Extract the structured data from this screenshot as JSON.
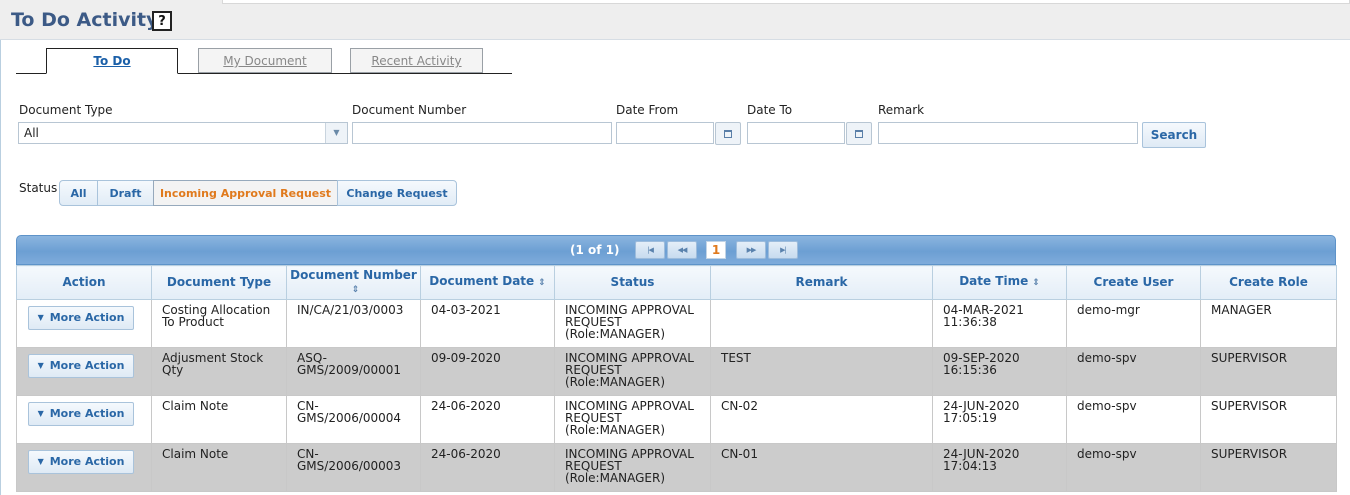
{
  "page": {
    "title": "To Do Activity",
    "help": "?"
  },
  "tabs": [
    {
      "label": "To Do",
      "active": true
    },
    {
      "label": "My Document",
      "active": false
    },
    {
      "label": "Recent Activity",
      "active": false
    }
  ],
  "filters": {
    "document_type": {
      "label": "Document Type",
      "value": "All"
    },
    "document_number": {
      "label": "Document Number",
      "value": ""
    },
    "date_from": {
      "label": "Date From",
      "value": ""
    },
    "date_to": {
      "label": "Date To",
      "value": ""
    },
    "remark": {
      "label": "Remark",
      "value": ""
    },
    "search_label": "Search"
  },
  "status": {
    "label": "Status",
    "options": [
      "All",
      "Draft",
      "Incoming Approval Request",
      "Change Request"
    ],
    "selected": "Incoming Approval Request"
  },
  "pager": {
    "text": "(1 of 1)",
    "current": "1"
  },
  "table": {
    "columns": [
      "Action",
      "Document Type",
      "Document Number",
      "Document Date",
      "Status",
      "Remark",
      "Date Time",
      "Create User",
      "Create Role"
    ],
    "action_label": "More Action",
    "rows": [
      {
        "document_type": [
          "Costing Allocation",
          "To Product"
        ],
        "document_number": [
          "IN/CA/21/03/0003"
        ],
        "document_date": "04-03-2021",
        "status": [
          "INCOMING APPROVAL",
          "REQUEST",
          "(Role:MANAGER)"
        ],
        "remark": "",
        "date_time": [
          "04-MAR-2021",
          "11:36:38"
        ],
        "create_user": "demo-mgr",
        "create_role": "MANAGER"
      },
      {
        "document_type": [
          "Adjusment Stock",
          "Qty"
        ],
        "document_number": [
          "ASQ-",
          "GMS/2009/00001"
        ],
        "document_date": "09-09-2020",
        "status": [
          "INCOMING APPROVAL",
          "REQUEST",
          "(Role:MANAGER)"
        ],
        "remark": "TEST",
        "date_time": [
          "09-SEP-2020",
          "16:15:36"
        ],
        "create_user": "demo-spv",
        "create_role": "SUPERVISOR"
      },
      {
        "document_type": [
          "Claim Note"
        ],
        "document_number": [
          "CN-",
          "GMS/2006/00004"
        ],
        "document_date": "24-06-2020",
        "status": [
          "INCOMING APPROVAL",
          "REQUEST",
          "(Role:MANAGER)"
        ],
        "remark": "CN-02",
        "date_time": [
          "24-JUN-2020",
          "17:05:19"
        ],
        "create_user": "demo-spv",
        "create_role": "SUPERVISOR"
      },
      {
        "document_type": [
          "Claim Note"
        ],
        "document_number": [
          "CN-",
          "GMS/2006/00003"
        ],
        "document_date": "24-06-2020",
        "status": [
          "INCOMING APPROVAL",
          "REQUEST",
          "(Role:MANAGER)"
        ],
        "remark": "CN-01",
        "date_time": [
          "24-JUN-2020",
          "17:04:13"
        ],
        "create_user": "demo-spv",
        "create_role": "SUPERVISOR"
      }
    ]
  },
  "colors": {
    "title": "#3c5a86",
    "link": "#2a67a6",
    "accent": "#e07a1d",
    "row_alt": "#cccccc"
  }
}
